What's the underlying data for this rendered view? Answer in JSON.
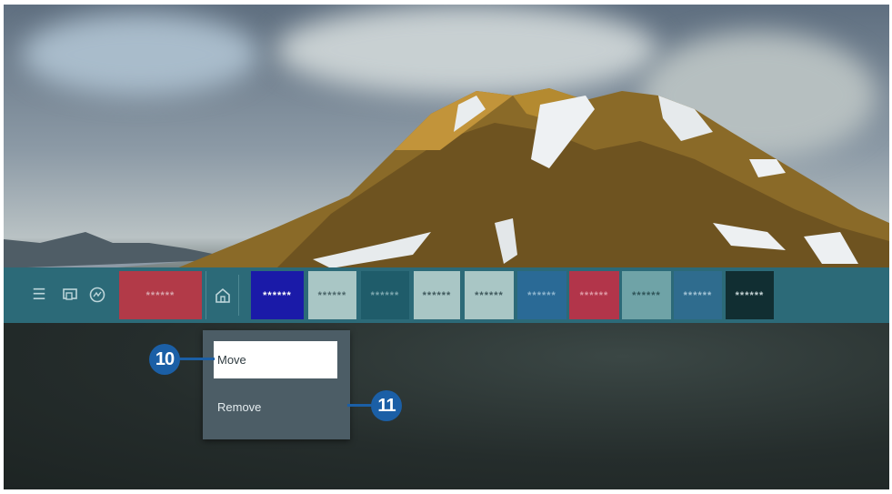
{
  "menu_bar": {
    "icons": [
      "menu-icon",
      "sources-icon",
      "ambient-icon",
      "home-icon"
    ],
    "tiles": [
      {
        "label": "******",
        "color": "#b23a48"
      },
      {
        "label": "******",
        "color": "#1a1aa8"
      },
      {
        "label": "******",
        "color": "#a9c6c5"
      },
      {
        "label": "******",
        "color": "#1f5c6a"
      },
      {
        "label": "******",
        "color": "#a9c6c5"
      },
      {
        "label": "******",
        "color": "#a9c6c5"
      },
      {
        "label": "******",
        "color": "#2a6a96"
      },
      {
        "label": "******",
        "color": "#b2354a"
      },
      {
        "label": "******",
        "color": "#6fa3a7"
      },
      {
        "label": "******",
        "color": "#2f6c8e"
      },
      {
        "label": "******",
        "color": "#112e32"
      }
    ]
  },
  "context_menu": {
    "items": [
      "Move",
      "Remove"
    ],
    "selected": "Move"
  },
  "callouts": [
    "10",
    "11"
  ],
  "colors": {
    "bar": "#2c6a78",
    "menu_bg": "#4c5d66",
    "callout": "#1b5fa6"
  }
}
